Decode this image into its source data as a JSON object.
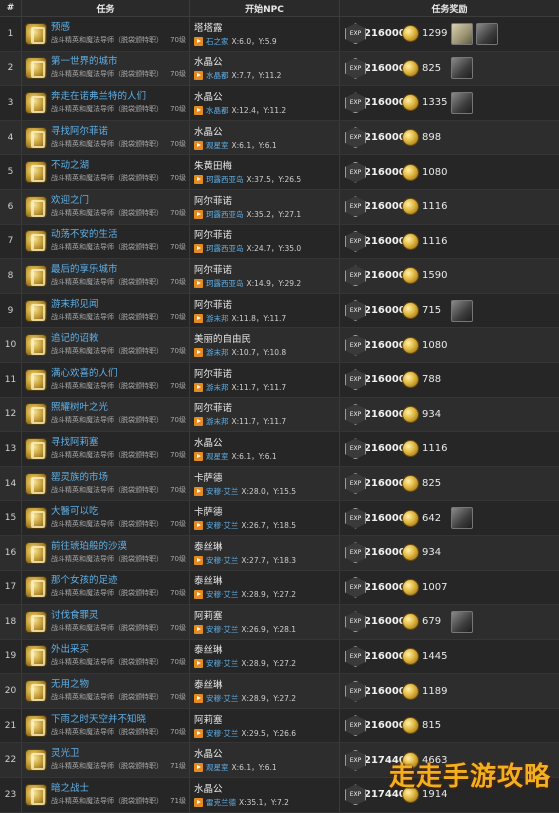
{
  "header": {
    "num": "#",
    "task": "任务",
    "npc": "开始NPC",
    "reward": "任务奖励"
  },
  "rows": [
    {
      "num": "1",
      "name": "预感",
      "sub": "战斗精英和魔法导师（脱袋颁特职）",
      "lvl": "70级",
      "npc": "塔塔露",
      "loc": "石之家",
      "coords": "X:6.0，Y:5.9",
      "exp": "216000",
      "gil": "1299",
      "items": [
        "map",
        "helm"
      ]
    },
    {
      "num": "2",
      "name": "第一世界的城市",
      "sub": "战斗精英和魔法导师（脱袋颁特职）",
      "lvl": "70级",
      "npc": "水晶公",
      "loc": "水晶都",
      "coords": "X:7.7，Y:11.2",
      "exp": "216000",
      "gil": "825",
      "items": [
        "armor"
      ]
    },
    {
      "num": "3",
      "name": "奔走在诺弗兰特的人们",
      "sub": "战斗精英和魔法导师（脱袋颁特职）",
      "lvl": "70级",
      "npc": "水晶公",
      "loc": "水晶都",
      "coords": "X:12.4，Y:11.2",
      "exp": "216000",
      "gil": "1335",
      "items": [
        "armor"
      ]
    },
    {
      "num": "4",
      "name": "寻找阿尔菲诺",
      "sub": "战斗精英和魔法导师（脱袋颁特职）",
      "lvl": "70级",
      "npc": "水晶公",
      "loc": "观星室",
      "coords": "X:6.1，Y:6.1",
      "exp": "216000",
      "gil": "898",
      "items": []
    },
    {
      "num": "5",
      "name": "不动之湖",
      "sub": "战斗精英和魔法导师（脱袋颁特职）",
      "lvl": "70级",
      "npc": "朱黄田梅",
      "loc": "珂露西亚岛",
      "coords": "X:37.5，Y:26.5",
      "exp": "216000",
      "gil": "1080",
      "items": []
    },
    {
      "num": "6",
      "name": "欢迎之门",
      "sub": "战斗精英和魔法导师（脱袋颁特职）",
      "lvl": "70级",
      "npc": "阿尔菲诺",
      "loc": "珂露西亚岛",
      "coords": "X:35.2，Y:27.1",
      "exp": "216000",
      "gil": "1116",
      "items": []
    },
    {
      "num": "7",
      "name": "动荡不安的生活",
      "sub": "战斗精英和魔法导师（脱袋颁特职）",
      "lvl": "70级",
      "npc": "阿尔菲诺",
      "loc": "珂露西亚岛",
      "coords": "X:24.7，Y:35.0",
      "exp": "216000",
      "gil": "1116",
      "items": []
    },
    {
      "num": "8",
      "name": "最后的享乐城市",
      "sub": "战斗精英和魔法导师（脱袋颁特职）",
      "lvl": "70级",
      "npc": "阿尔菲诺",
      "loc": "珂露西亚岛",
      "coords": "X:14.9，Y:29.2",
      "exp": "216000",
      "gil": "1590",
      "items": []
    },
    {
      "num": "9",
      "name": "游末邦见闻",
      "sub": "战斗精英和魔法导师（脱袋颁特职）",
      "lvl": "70级",
      "npc": "阿尔菲诺",
      "loc": "游末邦",
      "coords": "X:11.8，Y:11.7",
      "exp": "216000",
      "gil": "715",
      "items": [
        "armor"
      ]
    },
    {
      "num": "10",
      "name": "追记的诏敕",
      "sub": "战斗精英和魔法导师（脱袋颁特职）",
      "lvl": "70级",
      "npc": "美丽的自由民",
      "loc": "游末邦",
      "coords": "X:10.7，Y:10.8",
      "exp": "216000",
      "gil": "1080",
      "items": []
    },
    {
      "num": "11",
      "name": "满心欢喜的人们",
      "sub": "战斗精英和魔法导师（脱袋颁特职）",
      "lvl": "70级",
      "npc": "阿尔菲诺",
      "loc": "游末邦",
      "coords": "X:11.7，Y:11.7",
      "exp": "216000",
      "gil": "788",
      "items": []
    },
    {
      "num": "12",
      "name": "照耀树叶之光",
      "sub": "战斗精英和魔法导师（脱袋颁特职）",
      "lvl": "70级",
      "npc": "阿尔菲诺",
      "loc": "游末邦",
      "coords": "X:11.7，Y:11.7",
      "exp": "216000",
      "gil": "934",
      "items": []
    },
    {
      "num": "13",
      "name": "寻找阿莉塞",
      "sub": "战斗精英和魔法导师（脱袋颁特职）",
      "lvl": "70级",
      "npc": "水晶公",
      "loc": "观星室",
      "coords": "X:6.1，Y:6.1",
      "exp": "216000",
      "gil": "1116",
      "items": []
    },
    {
      "num": "14",
      "name": "罂灵族的市场",
      "sub": "战斗精英和魔法导师（脱袋颁特职）",
      "lvl": "70级",
      "npc": "卡萨德",
      "loc": "安穆·艾兰",
      "coords": "X:28.0，Y:15.5",
      "exp": "216000",
      "gil": "825",
      "items": []
    },
    {
      "num": "15",
      "name": "大醫可以吃",
      "sub": "战斗精英和魔法导师（脱袋颁特职）",
      "lvl": "70级",
      "npc": "卡萨德",
      "loc": "安穆·艾兰",
      "coords": "X:26.7，Y:18.5",
      "exp": "216000",
      "gil": "642",
      "items": [
        "armor"
      ]
    },
    {
      "num": "16",
      "name": "前往琥珀般的沙漠",
      "sub": "战斗精英和魔法导师（脱袋颁特职）",
      "lvl": "70级",
      "npc": "泰丝琳",
      "loc": "安穆·艾兰",
      "coords": "X:27.7，Y:18.3",
      "exp": "216000",
      "gil": "934",
      "items": []
    },
    {
      "num": "17",
      "name": "那个女孩的足迹",
      "sub": "战斗精英和魔法导师（脱袋颁特职）",
      "lvl": "70级",
      "npc": "泰丝琳",
      "loc": "安穆·艾兰",
      "coords": "X:28.9，Y:27.2",
      "exp": "216000",
      "gil": "1007",
      "items": []
    },
    {
      "num": "18",
      "name": "讨伐食罪灵",
      "sub": "战斗精英和魔法导师（脱袋颁特职）",
      "lvl": "70级",
      "npc": "阿莉塞",
      "loc": "安穆·艾兰",
      "coords": "X:26.9，Y:28.1",
      "exp": "216000",
      "gil": "679",
      "items": [
        "armor"
      ]
    },
    {
      "num": "19",
      "name": "外出采买",
      "sub": "战斗精英和魔法导师（脱袋颁特职）",
      "lvl": "70级",
      "npc": "泰丝琳",
      "loc": "安穆·艾兰",
      "coords": "X:28.9，Y:27.2",
      "exp": "216000",
      "gil": "1445",
      "items": []
    },
    {
      "num": "20",
      "name": "无用之物",
      "sub": "战斗精英和魔法导师（脱袋颁特职）",
      "lvl": "70级",
      "npc": "泰丝琳",
      "loc": "安穆·艾兰",
      "coords": "X:28.9，Y:27.2",
      "exp": "216000",
      "gil": "1189",
      "items": []
    },
    {
      "num": "21",
      "name": "下雨之时天空并不知晓",
      "sub": "战斗精英和魔法导师（脱袋颁特职）",
      "lvl": "70级",
      "npc": "阿莉塞",
      "loc": "安穆·艾兰",
      "coords": "X:29.5，Y:26.6",
      "exp": "216000",
      "gil": "815",
      "items": []
    },
    {
      "num": "22",
      "name": "灵光卫",
      "sub": "战斗精英和魔法导师（脱袋颁特职）",
      "lvl": "71级",
      "npc": "水晶公",
      "loc": "观星室",
      "coords": "X:6.1，Y:6.1",
      "exp": "217440",
      "gil": "4663",
      "items": []
    },
    {
      "num": "23",
      "name": "暗之战士",
      "sub": "战斗精英和魔法导师（脱袋颁特职）",
      "lvl": "71级",
      "npc": "水晶公",
      "loc": "雷克兰德",
      "coords": "X:35.1，Y:7.2",
      "exp": "217440",
      "gil": "1914",
      "items": []
    }
  ],
  "watermark": "走走手游攻略"
}
